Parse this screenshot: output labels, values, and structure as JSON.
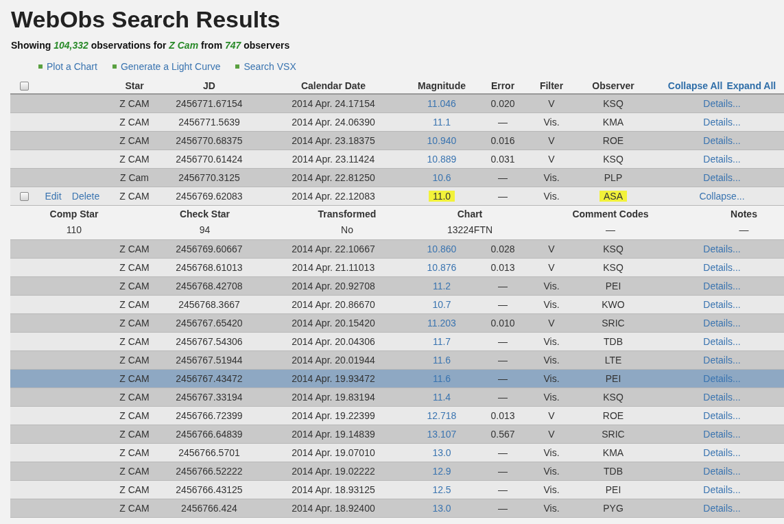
{
  "title": "WebObs Search Results",
  "summary": "Showing *104,332* observations for *Z Cam* from *747* observers",
  "links": [
    "Plot a Chart",
    "Generate a Light Curve",
    "Search VSX"
  ],
  "table": {
    "header_checkbox": {
      "checked": false
    },
    "columns": [
      "Star",
      "JD",
      "Calendar Date",
      "Magnitude",
      "Error",
      "Filter",
      "Observer"
    ],
    "header_links": [
      "Collapse All",
      "Expand All"
    ],
    "rows": [
      {
        "star": "Z CAM",
        "jd": "2456771.67154",
        "date": "2014 Apr. 24.17154",
        "magnitude": "11.046",
        "error": "0.020",
        "filter": "V",
        "observer": "KSQ",
        "action": "Details...",
        "selected": false
      },
      {
        "star": "Z CAM",
        "jd": "2456771.5639",
        "date": "2014 Apr. 24.06390",
        "magnitude": "11.1",
        "error": "—",
        "filter": "Vis.",
        "observer": "KMA",
        "action": "Details...",
        "selected": false
      },
      {
        "star": "Z CAM",
        "jd": "2456770.68375",
        "date": "2014 Apr. 23.18375",
        "magnitude": "10.940",
        "error": "0.016",
        "filter": "V",
        "observer": "ROE",
        "action": "Details...",
        "selected": false
      },
      {
        "star": "Z CAM",
        "jd": "2456770.61424",
        "date": "2014 Apr. 23.11424",
        "magnitude": "10.889",
        "error": "0.031",
        "filter": "V",
        "observer": "KSQ",
        "action": "Details...",
        "selected": false
      },
      {
        "star": "Z Cam",
        "jd": "2456770.3125",
        "date": "2014 Apr. 22.81250",
        "magnitude": "10.6",
        "error": "—",
        "filter": "Vis.",
        "observer": "PLP",
        "action": "Details...",
        "selected": false
      },
      {
        "star": "Z CAM",
        "jd": "2456769.62083",
        "date": "2014 Apr. 22.12083",
        "magnitude": "11.0",
        "error": "—",
        "filter": "Vis.",
        "observer": "ASA",
        "action": "Collapse...",
        "selected": false,
        "highlighted": true,
        "checked": false,
        "edit": "Edit",
        "delete": "Delete",
        "detail": {
          "columns": [
            "Comp Star",
            "Check Star",
            "Transformed",
            "Chart",
            "Comment Codes",
            "Notes"
          ],
          "values": [
            "110",
            "94",
            "No",
            "13224FTN",
            "—",
            "—"
          ]
        }
      },
      {
        "star": "Z CAM",
        "jd": "2456769.60667",
        "date": "2014 Apr. 22.10667",
        "magnitude": "10.860",
        "error": "0.028",
        "filter": "V",
        "observer": "KSQ",
        "action": "Details...",
        "selected": false
      },
      {
        "star": "Z CAM",
        "jd": "2456768.61013",
        "date": "2014 Apr. 21.11013",
        "magnitude": "10.876",
        "error": "0.013",
        "filter": "V",
        "observer": "KSQ",
        "action": "Details...",
        "selected": false
      },
      {
        "star": "Z CAM",
        "jd": "2456768.42708",
        "date": "2014 Apr. 20.92708",
        "magnitude": "11.2",
        "error": "—",
        "filter": "Vis.",
        "observer": "PEI",
        "action": "Details...",
        "selected": false
      },
      {
        "star": "Z CAM",
        "jd": "2456768.3667",
        "date": "2014 Apr. 20.86670",
        "magnitude": "10.7",
        "error": "—",
        "filter": "Vis.",
        "observer": "KWO",
        "action": "Details...",
        "selected": false
      },
      {
        "star": "Z CAM",
        "jd": "2456767.65420",
        "date": "2014 Apr. 20.15420",
        "magnitude": "11.203",
        "error": "0.010",
        "filter": "V",
        "observer": "SRIC",
        "action": "Details...",
        "selected": false
      },
      {
        "star": "Z CAM",
        "jd": "2456767.54306",
        "date": "2014 Apr. 20.04306",
        "magnitude": "11.7",
        "error": "—",
        "filter": "Vis.",
        "observer": "TDB",
        "action": "Details...",
        "selected": false
      },
      {
        "star": "Z CAM",
        "jd": "2456767.51944",
        "date": "2014 Apr. 20.01944",
        "magnitude": "11.6",
        "error": "—",
        "filter": "Vis.",
        "observer": "LTE",
        "action": "Details...",
        "selected": false
      },
      {
        "star": "Z CAM",
        "jd": "2456767.43472",
        "date": "2014 Apr. 19.93472",
        "magnitude": "11.6",
        "error": "—",
        "filter": "Vis.",
        "observer": "PEI",
        "action": "Details...",
        "selected": true
      },
      {
        "star": "Z CAM",
        "jd": "2456767.33194",
        "date": "2014 Apr. 19.83194",
        "magnitude": "11.4",
        "error": "—",
        "filter": "Vis.",
        "observer": "KSQ",
        "action": "Details...",
        "selected": false
      },
      {
        "star": "Z CAM",
        "jd": "2456766.72399",
        "date": "2014 Apr. 19.22399",
        "magnitude": "12.718",
        "error": "0.013",
        "filter": "V",
        "observer": "ROE",
        "action": "Details...",
        "selected": false
      },
      {
        "star": "Z CAM",
        "jd": "2456766.64839",
        "date": "2014 Apr. 19.14839",
        "magnitude": "13.107",
        "error": "0.567",
        "filter": "V",
        "observer": "SRIC",
        "action": "Details...",
        "selected": false
      },
      {
        "star": "Z CAM",
        "jd": "2456766.5701",
        "date": "2014 Apr. 19.07010",
        "magnitude": "13.0",
        "error": "—",
        "filter": "Vis.",
        "observer": "KMA",
        "action": "Details...",
        "selected": false
      },
      {
        "star": "Z CAM",
        "jd": "2456766.52222",
        "date": "2014 Apr. 19.02222",
        "magnitude": "12.9",
        "error": "—",
        "filter": "Vis.",
        "observer": "TDB",
        "action": "Details...",
        "selected": false
      },
      {
        "star": "Z CAM",
        "jd": "2456766.43125",
        "date": "2014 Apr. 18.93125",
        "magnitude": "12.5",
        "error": "—",
        "filter": "Vis.",
        "observer": "PEI",
        "action": "Details...",
        "selected": false
      },
      {
        "star": "Z CAM",
        "jd": "2456766.424",
        "date": "2014 Apr. 18.92400",
        "magnitude": "13.0",
        "error": "—",
        "filter": "Vis.",
        "observer": "PYG",
        "action": "Details...",
        "selected": false
      }
    ]
  }
}
